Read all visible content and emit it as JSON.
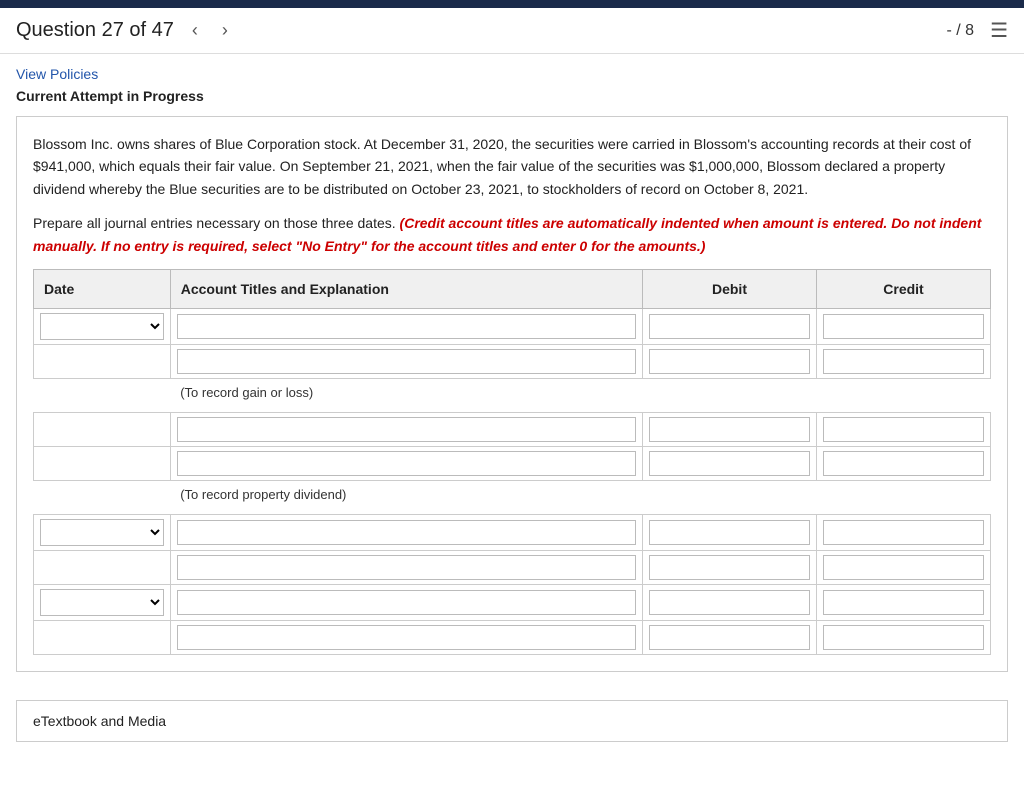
{
  "topbar": {},
  "header": {
    "question_label": "Question 27 of 47",
    "prev_arrow": "‹",
    "next_arrow": "›",
    "score": "- / 8",
    "list_icon": "☰"
  },
  "links": {
    "view_policies": "View Policies"
  },
  "status": {
    "current_attempt": "Current Attempt in Progress"
  },
  "question": {
    "body": "Blossom Inc. owns shares of Blue Corporation stock. At December 31, 2020, the securities were carried in Blossom's accounting records at their cost of $941,000, which equals their fair value. On September 21, 2021, when the fair value of the securities was $1,000,000, Blossom declared a property dividend whereby the Blue securities are to be distributed on October 23, 2021, to stockholders of record on October 8, 2021.",
    "prepare": "Prepare all journal entries necessary on those three dates.",
    "credit_note": "(Credit account titles are automatically indented when amount is entered. Do not indent manually. If no entry is required, select \"No Entry\" for the account titles and enter 0 for the amounts.)"
  },
  "table": {
    "headers": {
      "date": "Date",
      "account": "Account Titles and Explanation",
      "debit": "Debit",
      "credit": "Credit"
    },
    "note1": "(To record gain or loss)",
    "note2": "(To record property dividend)"
  },
  "etextbook": {
    "label": "eTextbook and Media"
  }
}
